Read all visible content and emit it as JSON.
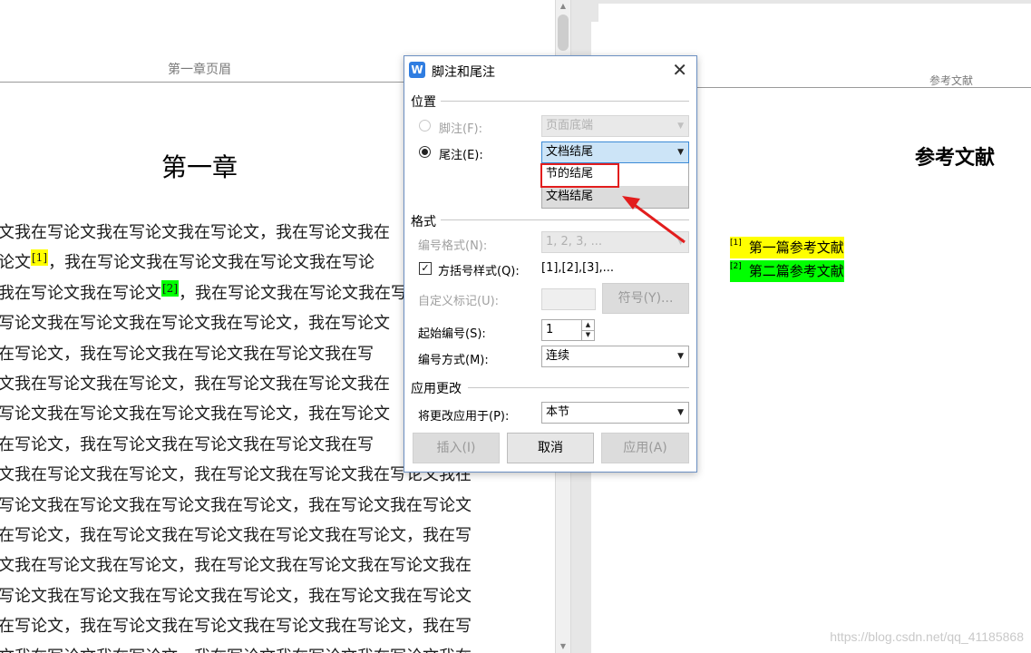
{
  "left_page": {
    "header": "第一章页眉",
    "chapter_title": "第一章",
    "lines": [
      {
        "before": "文我在写论文我在写论文我在写论文，我在写论文我在",
        "mark": "",
        "after": ""
      },
      {
        "before": "论文",
        "mark": "[1]",
        "after": "，我在写论文我在写论文我在写论文我在写论"
      },
      {
        "before": "我在写论文我在写论文",
        "mark": "[2]",
        "after": "，我在写论文我在写论文我在写"
      },
      {
        "before": "写论文我在写论文我在写论文我在写论文，我在写论文",
        "mark": "",
        "after": ""
      },
      {
        "before": "在写论文，我在写论文我在写论文我在写论文我在写",
        "mark": "",
        "after": ""
      },
      {
        "before": "文我在写论文我在写论文，我在写论文我在写论文我在",
        "mark": "",
        "after": ""
      },
      {
        "before": "写论文我在写论文我在写论文我在写论文，我在写论文",
        "mark": "",
        "after": ""
      },
      {
        "before": "在写论文，我在写论文我在写论文我在写论文我在写",
        "mark": "",
        "after": ""
      },
      {
        "before": "文我在写论文我在写论文，我在写论文我在写论文我在写论文我在",
        "mark": "",
        "after": ""
      },
      {
        "before": "写论文我在写论文我在写论文我在写论文，我在写论文我在写论文",
        "mark": "",
        "after": ""
      },
      {
        "before": "在写论文，我在写论文我在写论文我在写论文我在写论文，我在写",
        "mark": "",
        "after": ""
      },
      {
        "before": "文我在写论文我在写论文，我在写论文我在写论文我在写论文我在",
        "mark": "",
        "after": ""
      },
      {
        "before": "写论文我在写论文我在写论文我在写论文，我在写论文我在写论文",
        "mark": "",
        "after": ""
      },
      {
        "before": "在写论文，我在写论文我在写论文我在写论文我在写论文，我在写",
        "mark": "",
        "after": ""
      },
      {
        "before": "文我在写论文我在写论文，我在写论文我在写论文我在写论文我在",
        "mark": "",
        "after": ""
      }
    ]
  },
  "right_page": {
    "header": "参考文献",
    "title": "参考文献",
    "references": [
      {
        "marker": "[1]",
        "text": "第一篇参考文献",
        "color": "#ffff00"
      },
      {
        "marker": "[2]",
        "text": "第二篇参考文献",
        "color": "#00ff00"
      }
    ],
    "watermark": "https://blog.csdn.net/qq_41185868"
  },
  "dialog": {
    "title": "脚注和尾注",
    "app_icon": "W",
    "close_glyph": "✕",
    "position_group": "位置",
    "footnote_label": "脚注(F):",
    "footnote_value": "页面底端",
    "endnote_label": "尾注(E):",
    "endnote_value": "文档结尾",
    "endnote_options": [
      "节的结尾",
      "文档结尾"
    ],
    "format_group": "格式",
    "number_format_label": "编号格式(N):",
    "number_format_value": "1, 2, 3, ...",
    "bracket_style_label": "方括号样式(Q):",
    "bracket_style_checked": true,
    "bracket_style_value": "[1],[2],[3],...",
    "custom_mark_label": "自定义标记(U):",
    "symbol_button": "符号(Y)...",
    "start_number_label": "起始编号(S):",
    "start_number_value": "1",
    "numbering_label": "编号方式(M):",
    "numbering_value": "连续",
    "apply_group": "应用更改",
    "apply_to_label": "将更改应用于(P):",
    "apply_to_value": "本节",
    "insert_button": "插入(I)",
    "cancel_button": "取消",
    "apply_button": "应用(A)"
  },
  "colors": {
    "highlight_box": "#e21d1d",
    "annotation_arrow": "#e21d1d",
    "dialog_border": "#6b8fc2",
    "active_select": "#cce4f7"
  }
}
